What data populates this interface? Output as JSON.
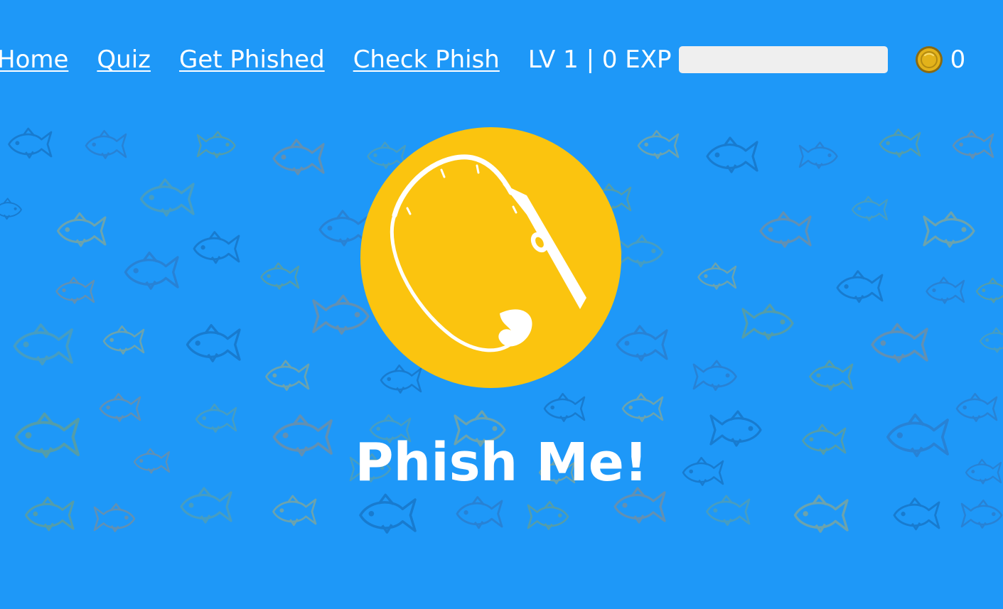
{
  "nav": {
    "links": [
      {
        "label": "Home"
      },
      {
        "label": "Quiz"
      },
      {
        "label": "Get Phished"
      },
      {
        "label": "Check Phish"
      }
    ],
    "level_text": "LV 1 | 0 EXP",
    "exp_progress_percent": 0,
    "coins": "0",
    "coin_icon": "coin-icon"
  },
  "hero": {
    "title": "Phish Me!",
    "logo_icon": "fishing-rod-icon",
    "background_pattern": "fish-pattern"
  },
  "colors": {
    "background": "#1e98f8",
    "logo_circle": "#fbc40f",
    "exp_track": "#efefef",
    "coin": "#e3b21a",
    "text": "#ffffff"
  }
}
